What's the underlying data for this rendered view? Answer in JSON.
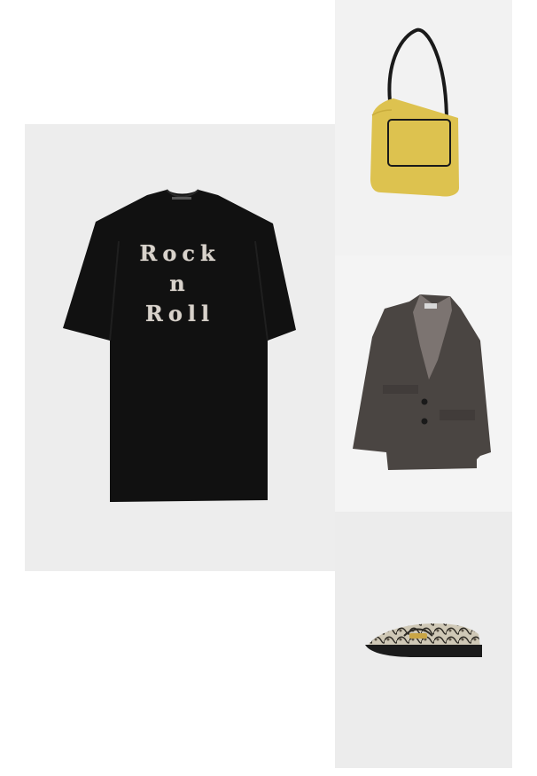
{
  "products": {
    "tshirt": {
      "print_line1": "Rock",
      "print_line2": "n",
      "print_line3": "Roll",
      "background": "#ededed",
      "garment_color": "#111111"
    },
    "bag": {
      "color": "#ddc24f"
    },
    "blazer": {
      "color": "#4a4542"
    },
    "loafer": {
      "pattern": "snakeskin"
    }
  }
}
